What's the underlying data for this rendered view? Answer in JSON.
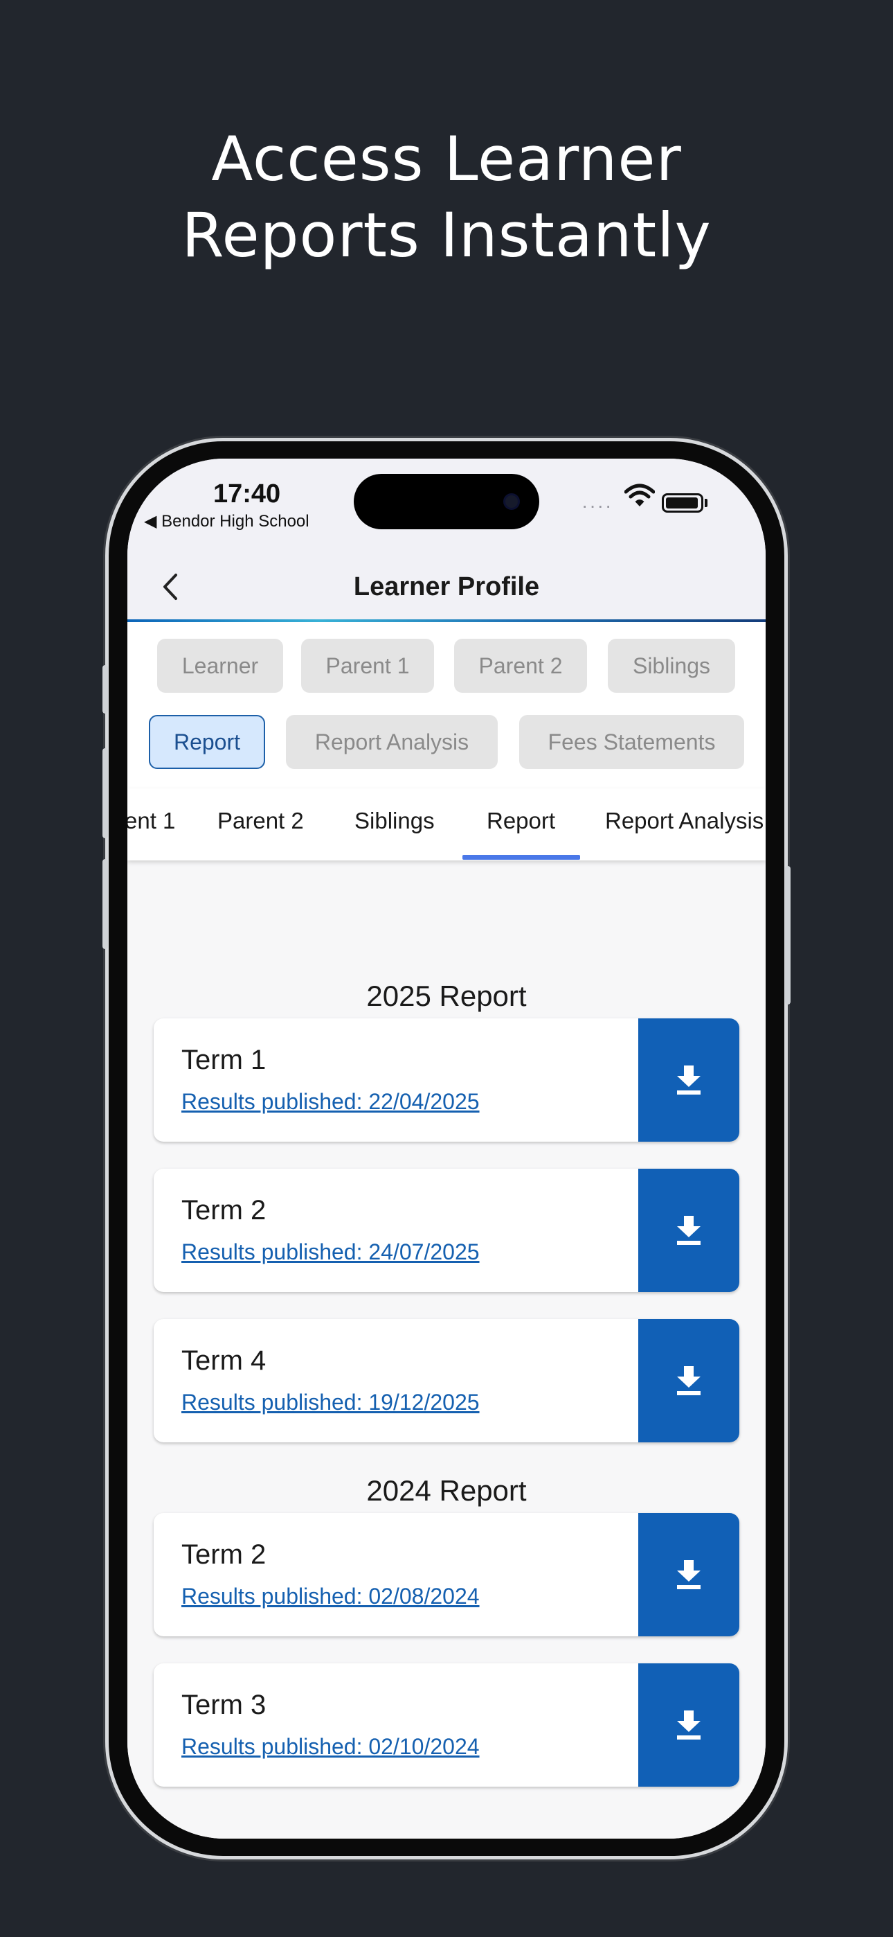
{
  "promo": {
    "headline_line1": "Access Learner",
    "headline_line2": "Reports Instantly"
  },
  "status_bar": {
    "time": "17:40",
    "back_app": "◀ Bendor High School"
  },
  "nav": {
    "title": "Learner Profile"
  },
  "chips": [
    {
      "label": "Learner",
      "active": false
    },
    {
      "label": "Parent 1",
      "active": false
    },
    {
      "label": "Parent 2",
      "active": false
    },
    {
      "label": "Siblings",
      "active": false
    },
    {
      "label": "Report",
      "active": true
    },
    {
      "label": "Report Analysis",
      "active": false
    },
    {
      "label": "Fees Statements",
      "active": false
    }
  ],
  "tabs": [
    {
      "label": "ent 1"
    },
    {
      "label": "Parent 2"
    },
    {
      "label": "Siblings"
    },
    {
      "label": "Report",
      "selected": true
    },
    {
      "label": "Report Analysis"
    }
  ],
  "reports": [
    {
      "title": "2025 Report",
      "terms": [
        {
          "term": "Term 1",
          "published": "Results published: 22/04/2025"
        },
        {
          "term": "Term 2",
          "published": "Results published: 24/07/2025"
        },
        {
          "term": "Term 4",
          "published": "Results published: 19/12/2025"
        }
      ]
    },
    {
      "title": "2024 Report",
      "terms": [
        {
          "term": "Term 2",
          "published": "Results published: 02/08/2024"
        },
        {
          "term": "Term 3",
          "published": "Results published: 02/10/2024"
        }
      ]
    }
  ],
  "icons": {
    "back": "chevron-left-icon",
    "download": "download-icon",
    "wifi": "wifi-icon",
    "battery": "battery-icon"
  },
  "colors": {
    "background": "#22262d",
    "accent": "#1160b6",
    "link": "#1560b0",
    "active_chip_bg": "#d6e8fd",
    "tab_indicator": "#4a78e8"
  }
}
